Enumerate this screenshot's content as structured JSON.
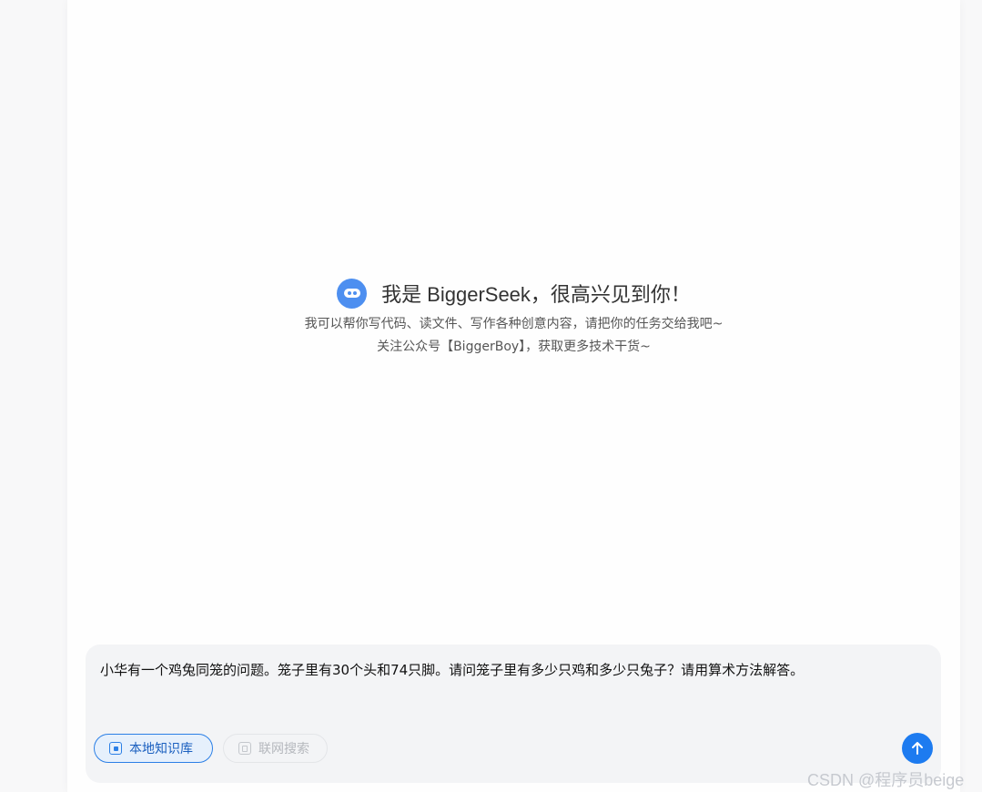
{
  "welcome": {
    "title": "我是 BiggerSeek，很高兴见到你！",
    "line1": "我可以帮你写代码、读文件、写作各种创意内容，请把你的任务交给我吧~",
    "line2": "关注公众号【BiggerBoy】，获取更多技术干货~"
  },
  "input": {
    "value": "小华有一个鸡兔同笼的问题。笼子里有30个头和74只脚。请问笼子里有多少只鸡和多少只兔子？请用算术方法解答。"
  },
  "toolbar": {
    "knowledge_base_label": "本地知识库",
    "web_search_label": "联网搜索"
  },
  "watermark": "CSDN @程序员beige",
  "colors": {
    "accent": "#1d7bf0",
    "logo": "#4d8ff0",
    "input_bg": "#f3f4f6"
  }
}
